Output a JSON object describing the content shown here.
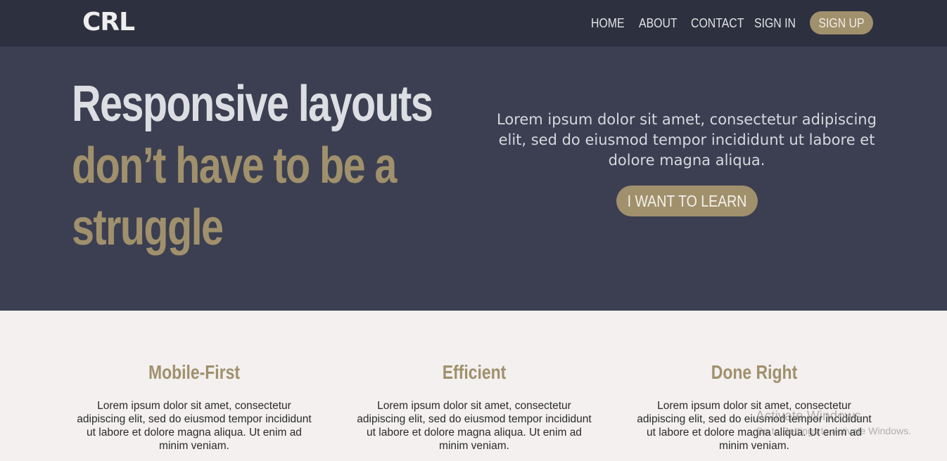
{
  "navbar": {
    "logo": "CRL",
    "links": [
      "HOME",
      "ABOUT",
      "CONTACT",
      "SIGN IN"
    ],
    "signup": "SIGN UP"
  },
  "hero": {
    "title_line_1": "Responsive layouts",
    "title_line_2": "don’t have to be a",
    "title_line_3": "struggle",
    "description": "Lorem ipsum dolor sit amet, consectetur adipiscing elit, sed do eiusmod tempor incididunt ut labore et dolore magna aliqua.",
    "cta": "I WANT TO LEARN"
  },
  "features": [
    {
      "title": "Mobile-First",
      "text": "Lorem ipsum dolor sit amet, consectetur adipiscing elit, sed do eiusmod tempor incididunt ut labore et dolore magna aliqua. Ut enim ad minim veniam."
    },
    {
      "title": "Efficient",
      "text": "Lorem ipsum dolor sit amet, consectetur adipiscing elit, sed do eiusmod tempor incididunt ut labore et dolore magna aliqua. Ut enim ad minim veniam."
    },
    {
      "title": "Done Right",
      "text": "Lorem ipsum dolor sit amet, consectetur adipiscing elit, sed do eiusmod tempor incididunt ut labore et dolore magna aliqua. Ut enim ad minim veniam."
    }
  ],
  "watermark": {
    "title": "Activate Windows",
    "subtitle": "Go to Settings to activate Windows."
  },
  "colors": {
    "navbar_bg": "#2d303e",
    "hero_bg": "#3b3f51",
    "accent": "#a0906c",
    "page_bg": "#f3f0ef"
  }
}
